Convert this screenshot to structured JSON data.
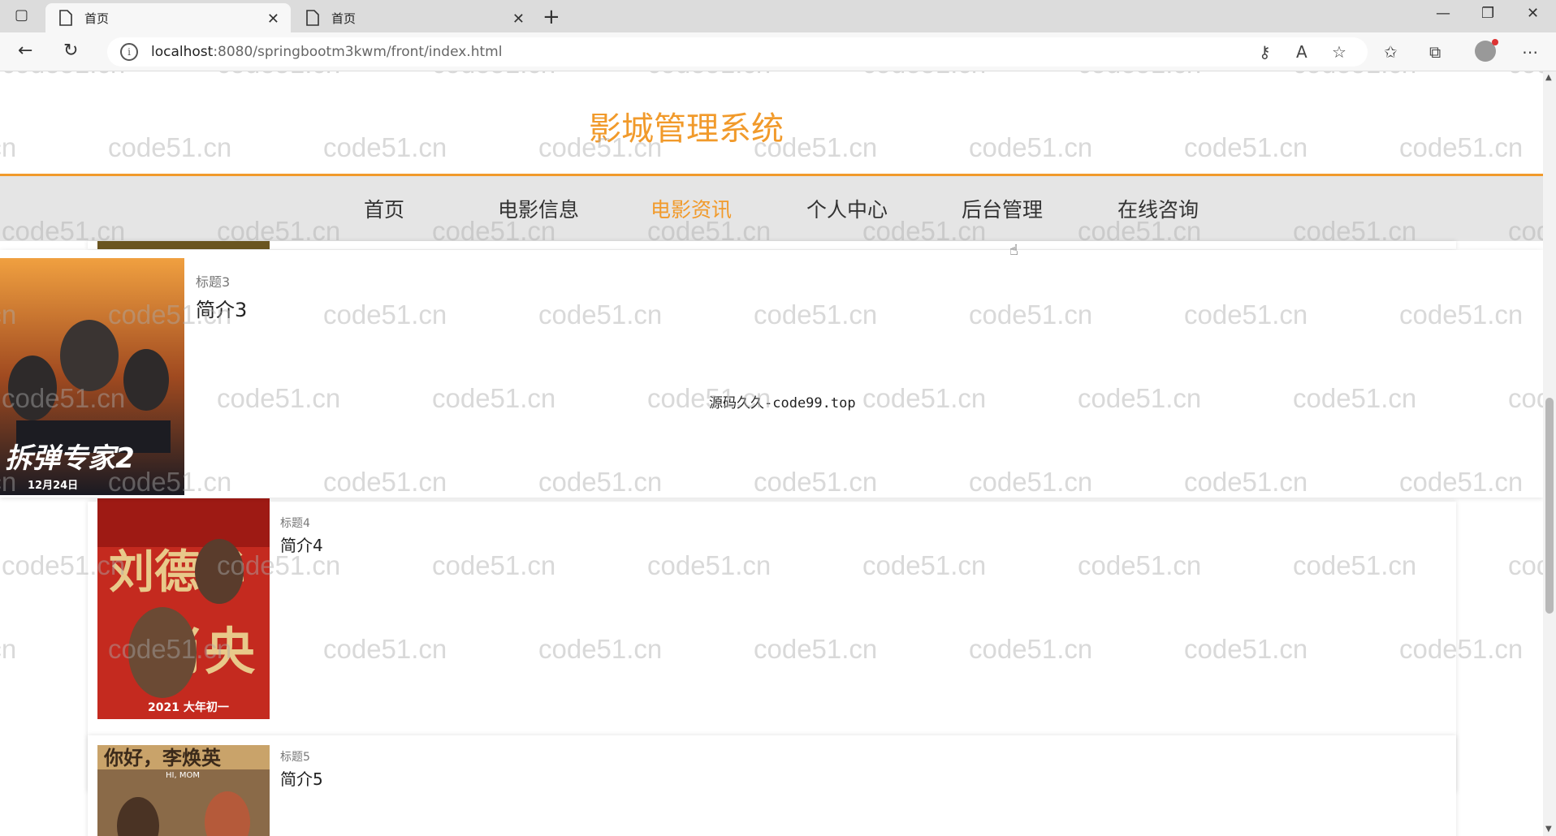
{
  "browser": {
    "tabs": [
      {
        "title": "首页"
      },
      {
        "title": "首页"
      }
    ],
    "url_host": "localhost",
    "url_path": ":8080/springbootm3kwm/front/index.html"
  },
  "site": {
    "title": "影城管理系统",
    "menu": [
      "首页",
      "电影信息",
      "电影资讯",
      "个人中心",
      "后台管理",
      "在线咨询"
    ],
    "active_menu": "电影资讯"
  },
  "overlay_item": {
    "title": "标题3",
    "desc": "简介3",
    "poster_text": "拆弹专家2",
    "poster_date": "12月24日",
    "source_text": "源码久久-code99.top"
  },
  "items": [
    {
      "title": "标题4",
      "desc": "简介4",
      "poster_text": "刘德华 肖央",
      "poster_sub": "2021 大年初一"
    },
    {
      "title": "标题5",
      "desc": "简介5",
      "poster_text": "你好，李焕英",
      "poster_sub": "HI, MOM"
    }
  ],
  "watermark": "code51.cn",
  "colors": {
    "accent": "#f19a2b",
    "menu_bg": "#e5e5e5"
  }
}
